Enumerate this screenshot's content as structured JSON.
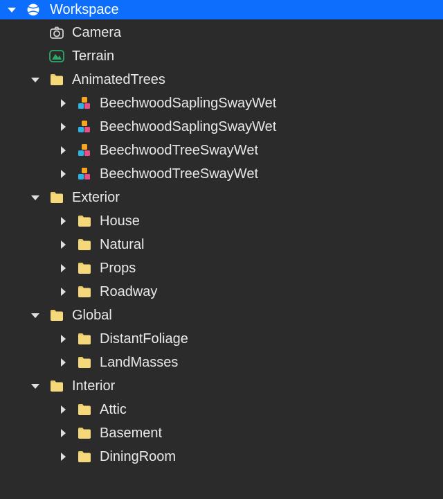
{
  "colors": {
    "header_bg": "#0d6efd",
    "bg": "#2b2b2b",
    "text": "#e8e8e8",
    "folder": "#f5d87a",
    "terrain": "#2da86a"
  },
  "root": {
    "label": "Workspace",
    "expanded": true
  },
  "items": [
    {
      "depth": 1,
      "icon": "camera",
      "toggle": "none",
      "label": "Camera"
    },
    {
      "depth": 1,
      "icon": "terrain",
      "toggle": "none",
      "label": "Terrain"
    },
    {
      "depth": 1,
      "icon": "folder",
      "toggle": "down",
      "label": "AnimatedTrees"
    },
    {
      "depth": 2,
      "icon": "model",
      "toggle": "right",
      "label": "BeechwoodSaplingSwayWet"
    },
    {
      "depth": 2,
      "icon": "model",
      "toggle": "right",
      "label": "BeechwoodSaplingSwayWet"
    },
    {
      "depth": 2,
      "icon": "model",
      "toggle": "right",
      "label": "BeechwoodTreeSwayWet"
    },
    {
      "depth": 2,
      "icon": "model",
      "toggle": "right",
      "label": "BeechwoodTreeSwayWet"
    },
    {
      "depth": 1,
      "icon": "folder",
      "toggle": "down",
      "label": "Exterior"
    },
    {
      "depth": 2,
      "icon": "folder",
      "toggle": "right",
      "label": "House"
    },
    {
      "depth": 2,
      "icon": "folder",
      "toggle": "right",
      "label": "Natural"
    },
    {
      "depth": 2,
      "icon": "folder",
      "toggle": "right",
      "label": "Props"
    },
    {
      "depth": 2,
      "icon": "folder",
      "toggle": "right",
      "label": "Roadway"
    },
    {
      "depth": 1,
      "icon": "folder",
      "toggle": "down",
      "label": "Global"
    },
    {
      "depth": 2,
      "icon": "folder",
      "toggle": "right",
      "label": "DistantFoliage"
    },
    {
      "depth": 2,
      "icon": "folder",
      "toggle": "right",
      "label": "LandMasses"
    },
    {
      "depth": 1,
      "icon": "folder",
      "toggle": "down",
      "label": "Interior"
    },
    {
      "depth": 2,
      "icon": "folder",
      "toggle": "right",
      "label": "Attic"
    },
    {
      "depth": 2,
      "icon": "folder",
      "toggle": "right",
      "label": "Basement"
    },
    {
      "depth": 2,
      "icon": "folder",
      "toggle": "right",
      "label": "DiningRoom"
    }
  ]
}
